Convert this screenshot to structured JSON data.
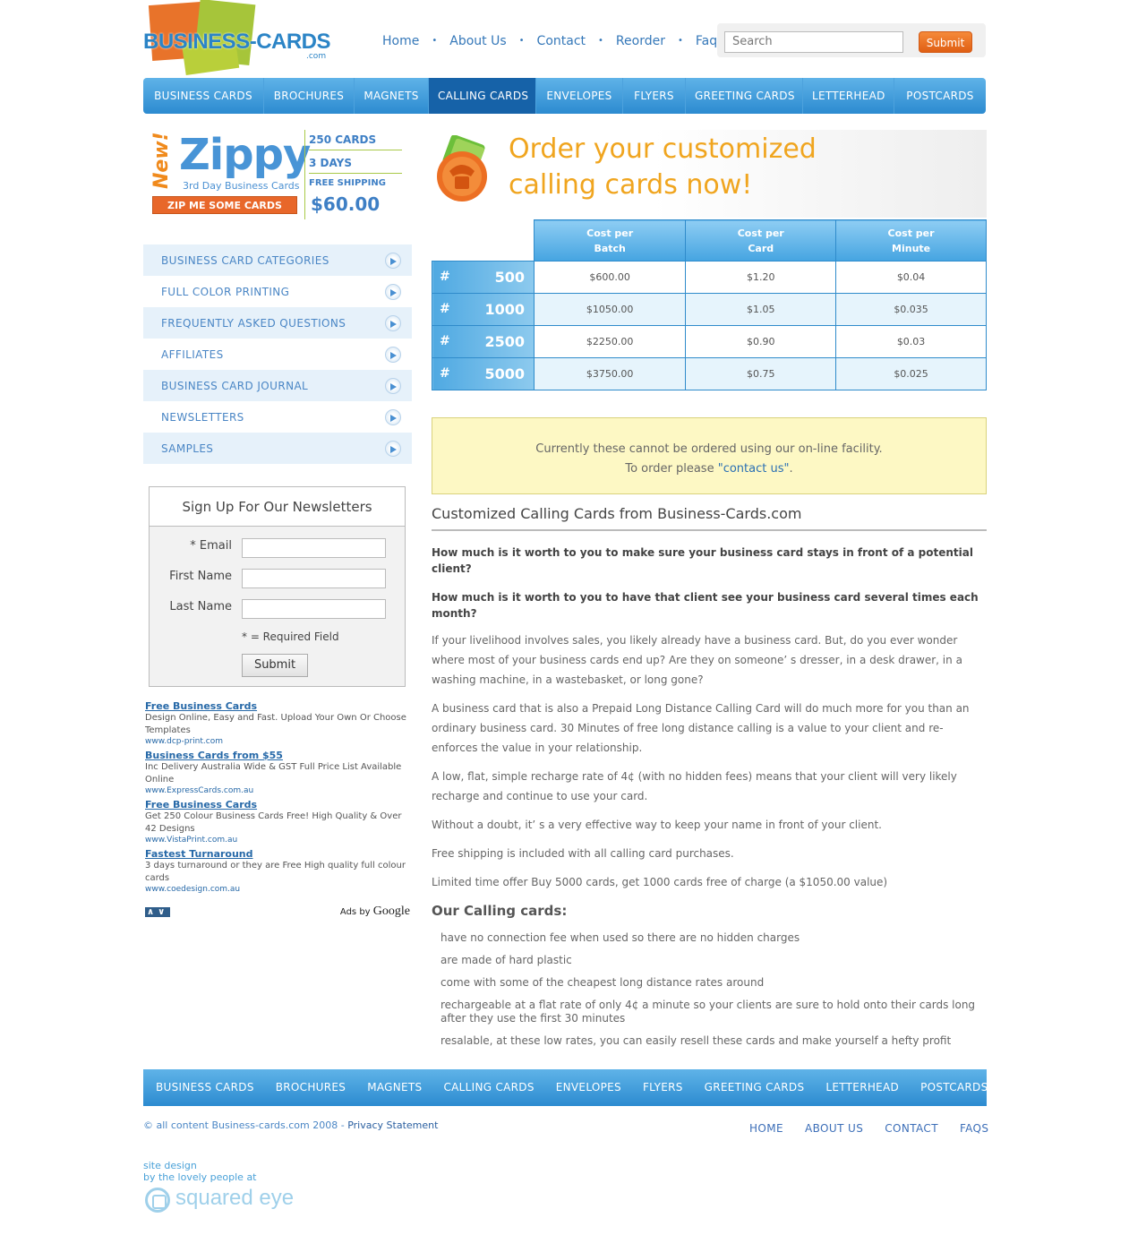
{
  "brand": {
    "logo_text": "BUSINESS-CARDS",
    "logo_sub": ".com"
  },
  "top_nav": [
    "Home",
    "About Us",
    "Contact",
    "Reorder",
    "Faqs"
  ],
  "search": {
    "placeholder": "Search",
    "submit_label": "Submit"
  },
  "main_nav": {
    "tabs": [
      "BUSINESS CARDS",
      "BROCHURES",
      "MAGNETS",
      "CALLING CARDS",
      "ENVELOPES",
      "FLYERS",
      "GREETING CARDS",
      "LETTERHEAD",
      "POSTCARDS"
    ],
    "active": "CALLING CARDS"
  },
  "zippy": {
    "new_label": "New!",
    "title": "Zippy",
    "subtitle": "3rd Day Business Cards",
    "cta": "ZIP ME SOME CARDS NOW!",
    "cards": "250 CARDS",
    "days": "3 DAYS",
    "shipping": "FREE SHIPPING",
    "price": "$60.00"
  },
  "sidebar": {
    "items": [
      "BUSINESS CARD CATEGORIES",
      "FULL COLOR PRINTING",
      "FREQUENTLY ASKED QUESTIONS",
      "AFFILIATES",
      "BUSINESS CARD JOURNAL",
      "NEWSLETTERS",
      "SAMPLES"
    ]
  },
  "newsletter": {
    "title": "Sign Up For Our Newsletters",
    "email_label": "* Email",
    "first_name_label": "First Name",
    "last_name_label": "Last Name",
    "required_note": "* = Required Field",
    "submit_label": "Submit"
  },
  "ads": [
    {
      "title": "Free Business Cards",
      "desc": "Design Online, Easy and Fast. Upload Your Own Or Choose Templates",
      "url": "www.dcp-print.com"
    },
    {
      "title": "Business Cards from $55",
      "desc": "Inc Delivery Australia Wide & GST Full Price List Available Online",
      "url": "www.ExpressCards.com.au"
    },
    {
      "title": "Free Business Cards",
      "desc": "Get 250 Colour Business Cards Free! High Quality & Over 42 Designs",
      "url": "www.VistaPrint.com.au"
    },
    {
      "title": "Fastest Turnaround",
      "desc": "3 days turnaround or they are Free High quality full colour cards",
      "url": "www.coedesign.com.au"
    }
  ],
  "ads_footer": {
    "nav": "∧∨",
    "ads_by": "Ads by",
    "google": "Google"
  },
  "hero": {
    "heading_line1": "Order your customized",
    "heading_line2": "calling cards now!"
  },
  "price_table": {
    "headers": [
      [
        "Cost per",
        "Batch"
      ],
      [
        "Cost per",
        "Card"
      ],
      [
        "Cost per",
        "Minute"
      ]
    ],
    "rows": [
      {
        "hash": "#",
        "qty": "500",
        "batch": "$600.00",
        "card": "$1.20",
        "minute": "$0.04"
      },
      {
        "hash": "#",
        "qty": "1000",
        "batch": "$1050.00",
        "card": "$1.05",
        "minute": "$0.035"
      },
      {
        "hash": "#",
        "qty": "2500",
        "batch": "$2250.00",
        "card": "$0.90",
        "minute": "$0.03"
      },
      {
        "hash": "#",
        "qty": "5000",
        "batch": "$3750.00",
        "card": "$0.75",
        "minute": "$0.025"
      }
    ]
  },
  "notice": {
    "line1": "Currently these cannot be ordered using our on-line facility.",
    "line2_prefix": "To order please ",
    "link": "\"contact us\"",
    "line2_suffix": "."
  },
  "content": {
    "heading": "Customized Calling Cards from Business-Cards.com",
    "question1": "How much is it worth to you to make sure your business card stays in front of a potential client?",
    "question2": "How much is it worth to you to have that client see your business card several times each month?",
    "paragraphs": [
      "If your livelihood involves sales, you likely already have a business card. But, do you ever wonder where most of your business cards end up? Are they on someone’ s dresser, in a desk drawer, in a washing machine, in a wastebasket, or long gone?",
      "A business card that is also a Prepaid Long Distance Calling Card will do much more for you than an ordinary business card. 30 Minutes of free long distance calling is a value to your client and re-enforces the value in your relationship.",
      "A low, flat, simple recharge rate of 4¢ (with no hidden fees) means that your client will very likely recharge and continue to use your card.",
      "Without a doubt, it’ s a very effective way to keep your name in front of your client.",
      "Free shipping is included with all calling card purchases.",
      "Limited time offer Buy 5000 cards, get 1000 cards free of charge (a $1050.00 value)"
    ],
    "list_heading": "Our Calling cards:",
    "list": [
      "have no connection fee when used so there are no hidden charges",
      "are made of hard plastic",
      "come with some of the cheapest long distance rates around",
      "rechargeable at a flat rate of only 4¢ a minute so your clients are sure to hold onto their cards long after they use the first 30 minutes",
      "resalable, at these low rates, you can easily resell these cards and make yourself a hefty profit"
    ]
  },
  "footer": {
    "nav": [
      "BUSINESS CARDS",
      "BROCHURES",
      "MAGNETS",
      "CALLING CARDS",
      "ENVELOPES",
      "FLYERS",
      "GREETING CARDS",
      "LETTERHEAD",
      "POSTCARDS"
    ],
    "copyright": "© all content Business-cards.com 2008 - ",
    "privacy": "Privacy Statement",
    "links": [
      "HOME",
      "ABOUT US",
      "CONTACT",
      "FAQS"
    ],
    "credit_line1": "site design",
    "credit_line2": "by the lovely people at",
    "credit_brand": "squared eye"
  },
  "colors": {
    "brand_blue": "#2c8bd0",
    "active_tab": "#1662a8",
    "accent_orange": "#e8672a",
    "hero_heading": "#f0a51f",
    "notice_bg": "#fdf8c4"
  }
}
